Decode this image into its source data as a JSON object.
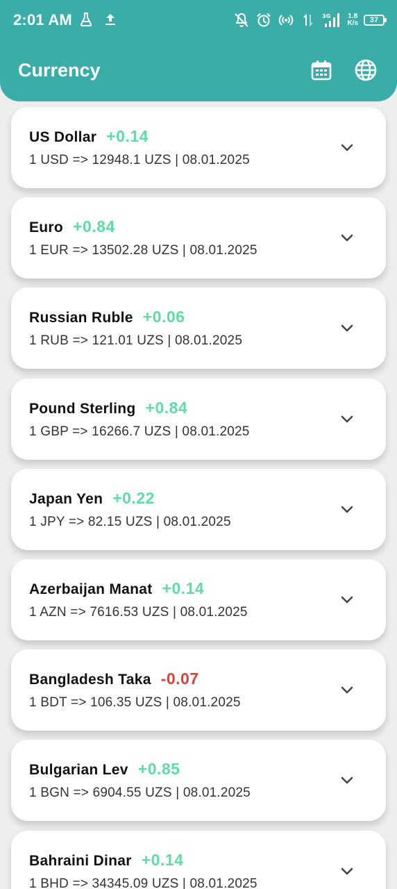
{
  "status_bar": {
    "time": "2:01 AM",
    "net_speed_value": "1.8",
    "net_speed_unit": "K/s",
    "net_type": "3G",
    "battery": "37"
  },
  "app_bar": {
    "title": "Currency",
    "calendar_icon": "calendar-icon",
    "language_icon": "globe-icon"
  },
  "colors": {
    "primary": "#3aada8",
    "positive": "#5fdca3",
    "negative": "#d9443a"
  },
  "currencies": [
    {
      "name": "US Dollar",
      "change": "+0.14",
      "trend": "up",
      "detail": "1 USD => 12948.1 UZS |  08.01.2025"
    },
    {
      "name": "Euro",
      "change": "+0.84",
      "trend": "up",
      "detail": "1 EUR => 13502.28 UZS |  08.01.2025"
    },
    {
      "name": "Russian Ruble",
      "change": "+0.06",
      "trend": "up",
      "detail": "1 RUB => 121.01 UZS |  08.01.2025"
    },
    {
      "name": "Pound Sterling",
      "change": "+0.84",
      "trend": "up",
      "detail": "1 GBP => 16266.7 UZS |  08.01.2025"
    },
    {
      "name": "Japan Yen",
      "change": "+0.22",
      "trend": "up",
      "detail": "1 JPY => 82.15 UZS |  08.01.2025"
    },
    {
      "name": "Azerbaijan Manat",
      "change": "+0.14",
      "trend": "up",
      "detail": "1 AZN => 7616.53 UZS |  08.01.2025"
    },
    {
      "name": "Bangladesh Taka",
      "change": "-0.07",
      "trend": "down",
      "detail": "1 BDT => 106.35 UZS |  08.01.2025"
    },
    {
      "name": "Bulgarian Lev",
      "change": "+0.85",
      "trend": "up",
      "detail": "1 BGN => 6904.55 UZS |  08.01.2025"
    },
    {
      "name": "Bahraini Dinar",
      "change": "+0.14",
      "trend": "up",
      "detail": "1 BHD => 34345.09 UZS |  08.01.2025"
    }
  ]
}
